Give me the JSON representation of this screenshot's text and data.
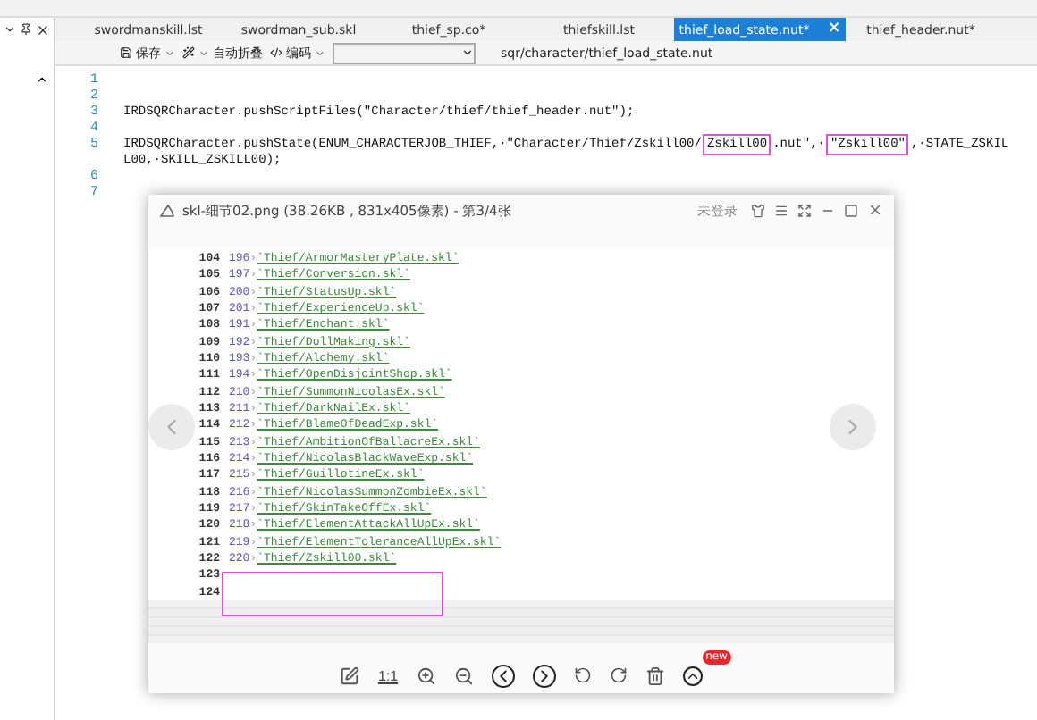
{
  "tabs": [
    {
      "label": "swordmanskill.lst",
      "selected": false
    },
    {
      "label": "swordman_sub.skl",
      "selected": false
    },
    {
      "label": "thief_sp.co*",
      "selected": false
    },
    {
      "label": "thiefskill.lst",
      "selected": false
    },
    {
      "label": "thief_load_state.nut*",
      "selected": true
    },
    {
      "label": "thief_header.nut*",
      "selected": false
    }
  ],
  "tab_close": "×",
  "toolbar": {
    "save": "保存",
    "fold": "自动折叠",
    "encoding": "编码",
    "path": "sqr/character/thief_load_state.nut"
  },
  "code_lines": [
    {
      "number": "1"
    },
    {
      "number": "2"
    },
    {
      "number": "3",
      "segments": [
        {
          "text": "IRDSQRCharacter.pushScriptFiles(\"Character/thief/thief_header.nut\");"
        }
      ]
    },
    {
      "number": "4"
    },
    {
      "number": "5",
      "segments": [
        {
          "text": "IRDSQRCharacter.pushState(ENUM_CHARACTERJOB_THIEF,·\"Character/Thief/Zskill00/"
        },
        {
          "text": "Zskill00",
          "boxed": true
        },
        {
          "text": ".nut\",·"
        },
        {
          "text": "\"Zskill00\"",
          "boxed": true
        },
        {
          "text": ",·STATE_ZSKIL"
        }
      ],
      "continuation": "L00,·SKILL_ZSKILL00);"
    },
    {
      "number": "6"
    },
    {
      "number": "7"
    }
  ],
  "viewer": {
    "title": "skl-细节02.png (38.26KB , 831x405像素) - 第3/4张",
    "login": "未登录",
    "tab_marker": "›",
    "rows": [
      {
        "line": "104",
        "id": "196",
        "path": "`Thief/ArmorMasteryPlate.skl`"
      },
      {
        "line": "105",
        "id": "197",
        "path": "`Thief/Conversion.skl`"
      },
      {
        "line": "106",
        "id": "200",
        "path": "`Thief/StatusUp.skl`"
      },
      {
        "line": "107",
        "id": "201",
        "path": "`Thief/ExperienceUp.skl`"
      },
      {
        "line": "108",
        "id": "191",
        "path": "`Thief/Enchant.skl`"
      },
      {
        "line": "109",
        "id": "192",
        "path": "`Thief/DollMaking.skl`"
      },
      {
        "line": "110",
        "id": "193",
        "path": "`Thief/Alchemy.skl`"
      },
      {
        "line": "111",
        "id": "194",
        "path": "`Thief/OpenDisjointShop.skl`"
      },
      {
        "line": "112",
        "id": "210",
        "path": "`Thief/SummonNicolasEx.skl`"
      },
      {
        "line": "113",
        "id": "211",
        "path": "`Thief/DarkNailEx.skl`"
      },
      {
        "line": "114",
        "id": "212",
        "path": "`Thief/BlameOfDeadExp.skl`"
      },
      {
        "line": "115",
        "id": "213",
        "path": "`Thief/AmbitionOfBallacreEx.skl`"
      },
      {
        "line": "116",
        "id": "214",
        "path": "`Thief/NicolasBlackWaveExp.skl`"
      },
      {
        "line": "117",
        "id": "215",
        "path": "`Thief/GuillotineEx.skl`"
      },
      {
        "line": "118",
        "id": "216",
        "path": "`Thief/NicolasSummonZombieEx.skl`"
      },
      {
        "line": "119",
        "id": "217",
        "path": "`Thief/SkinTakeOffEx.skl`"
      },
      {
        "line": "120",
        "id": "218",
        "path": "`Thief/ElementAttackAllUpEx.skl`"
      },
      {
        "line": "121",
        "id": "219",
        "path": "`Thief/ElementToleranceAllUpEx.skl`"
      },
      {
        "line": "122",
        "id": "220",
        "path": "`Thief/Zskill00.skl`"
      },
      {
        "line": "123"
      },
      {
        "line": "124"
      }
    ],
    "actual_size": "1:1",
    "badge": "new"
  }
}
